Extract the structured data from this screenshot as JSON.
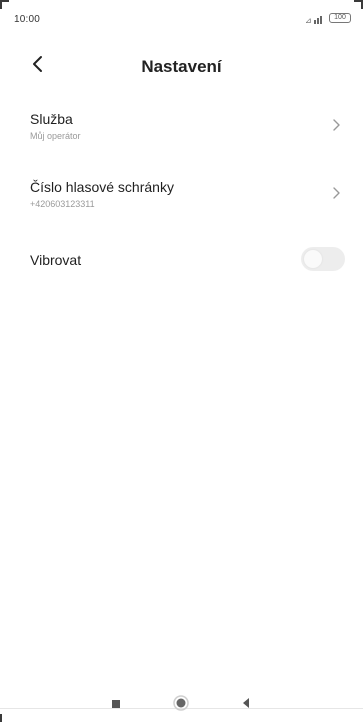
{
  "status_bar": {
    "time": "10:00",
    "battery": "100"
  },
  "header": {
    "title": "Nastavení"
  },
  "settings": [
    {
      "title": "Služba",
      "subtitle": "Můj operátor"
    },
    {
      "title": "Číslo hlasové schránky",
      "subtitle": "+420603123311"
    }
  ],
  "vibrate": {
    "label": "Vibrovat",
    "enabled": false
  },
  "colors": {
    "text": "#1f1f1f",
    "subtext": "#9a9a9a",
    "toggle_off": "#ededed"
  },
  "icons": {
    "back": "back-arrow-icon",
    "chevron": "chevron-right-icon",
    "signal": "signal-icon",
    "battery": "battery-icon",
    "nav_recent": "square-icon",
    "nav_home": "circle-icon",
    "nav_back": "triangle-back-icon"
  }
}
